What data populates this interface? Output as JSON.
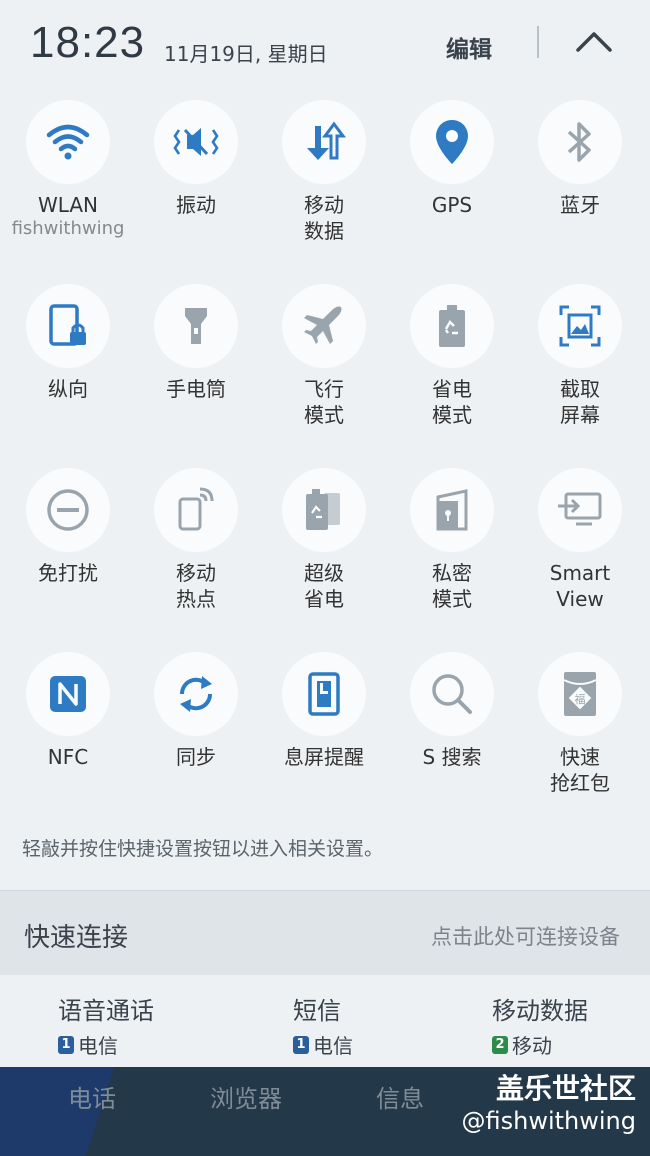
{
  "status": {
    "time": "18:23",
    "date": "11月19日, 星期日",
    "edit_label": "编辑"
  },
  "tiles": [
    {
      "id": "wlan",
      "label": "WLAN",
      "sub": "fishwithwing",
      "icon": "wifi-icon"
    },
    {
      "id": "vibrate",
      "label": "振动",
      "icon": "vibrate-icon"
    },
    {
      "id": "mobile-data",
      "label": "移动\n数据",
      "icon": "mobile-data-icon"
    },
    {
      "id": "gps",
      "label": "GPS",
      "icon": "location-pin-icon"
    },
    {
      "id": "bluetooth",
      "label": "蓝牙",
      "icon": "bluetooth-icon"
    },
    {
      "id": "portrait",
      "label": "纵向",
      "icon": "portrait-lock-icon"
    },
    {
      "id": "flashlight",
      "label": "手电筒",
      "icon": "flashlight-icon"
    },
    {
      "id": "airplane",
      "label": "飞行\n模式",
      "icon": "airplane-icon"
    },
    {
      "id": "power-saving",
      "label": "省电\n模式",
      "icon": "battery-recycle-icon"
    },
    {
      "id": "screenshot",
      "label": "截取\n屏幕",
      "icon": "screenshot-icon"
    },
    {
      "id": "dnd",
      "label": "免打扰",
      "icon": "minus-circle-icon"
    },
    {
      "id": "hotspot",
      "label": "移动\n热点",
      "icon": "hotspot-icon"
    },
    {
      "id": "ultra-power-saving",
      "label": "超级\n省电",
      "icon": "ultra-battery-icon"
    },
    {
      "id": "private",
      "label": "私密\n模式",
      "icon": "private-door-icon"
    },
    {
      "id": "smart-view",
      "label": "Smart\nView",
      "icon": "cast-screen-icon"
    },
    {
      "id": "nfc",
      "label": "NFC",
      "icon": "nfc-icon"
    },
    {
      "id": "sync",
      "label": "同步",
      "icon": "sync-icon"
    },
    {
      "id": "aod",
      "label": "息屏提醒",
      "icon": "screen-note-icon"
    },
    {
      "id": "s-search",
      "label": "S 搜索",
      "icon": "search-icon"
    },
    {
      "id": "red-envelope",
      "label": "快速\n抢红包",
      "icon": "red-envelope-icon"
    }
  ],
  "hint": "轻敲并按住快捷设置按钮以进入相关设置。",
  "quick_connect": {
    "title": "快速连接",
    "hint": "点击此处可连接设备"
  },
  "sims": [
    {
      "title": "语音通话",
      "slot": "1",
      "carrier": "电信",
      "color": "#2a5e9c"
    },
    {
      "title": "短信",
      "slot": "1",
      "carrier": "电信",
      "color": "#2a5e9c"
    },
    {
      "title": "移动数据",
      "slot": "2",
      "carrier": "移动",
      "color": "#2e8b4a"
    }
  ],
  "dock": [
    "电话",
    "浏览器",
    "信息"
  ],
  "watermark": {
    "line1": "盖乐世社区",
    "line2": "@fishwithwing"
  },
  "colors": {
    "active_icon": "#2e7bc4",
    "inactive_icon": "#9aa4ad"
  }
}
